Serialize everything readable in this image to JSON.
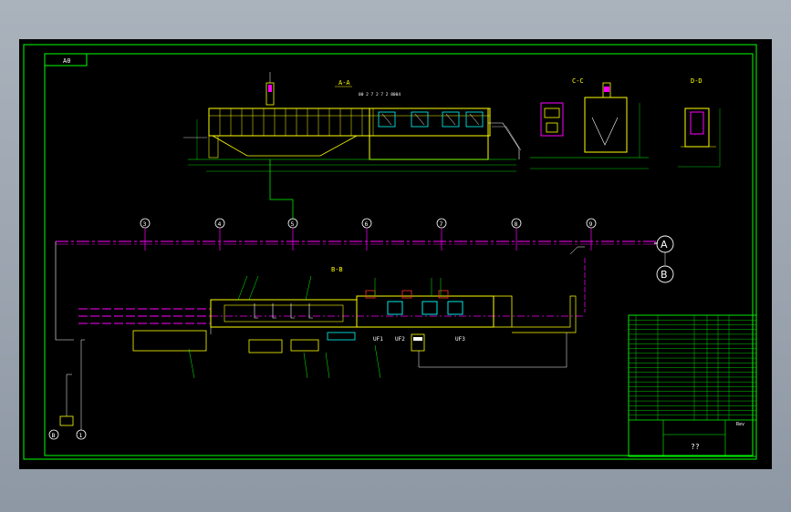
{
  "sheet": {
    "size_tag": "A0",
    "section_labels": {
      "aa": "A-A",
      "bb": "B-B",
      "cc": "C-C",
      "dd": "D-D"
    },
    "grid_axes": {
      "numbers": [
        "3",
        "4",
        "5",
        "6",
        "7",
        "8",
        "9"
      ],
      "letters": [
        "A",
        "B"
      ],
      "left_markers": [
        "B",
        "1"
      ]
    },
    "callouts": {
      "uf1": "UF1",
      "uf2": "UF2",
      "uf3": "UF3"
    },
    "dim_note": "00 2 7 2 7 2  8004"
  },
  "title_block": {
    "title": "??",
    "rev_mark": "Rev"
  },
  "colors": {
    "background": "#000000",
    "frame": "#00ff00",
    "yellow": "#ffff00",
    "magenta": "#ff00ff",
    "cyan": "#00ffff",
    "white": "#ffffff",
    "red": "#ff3030"
  }
}
